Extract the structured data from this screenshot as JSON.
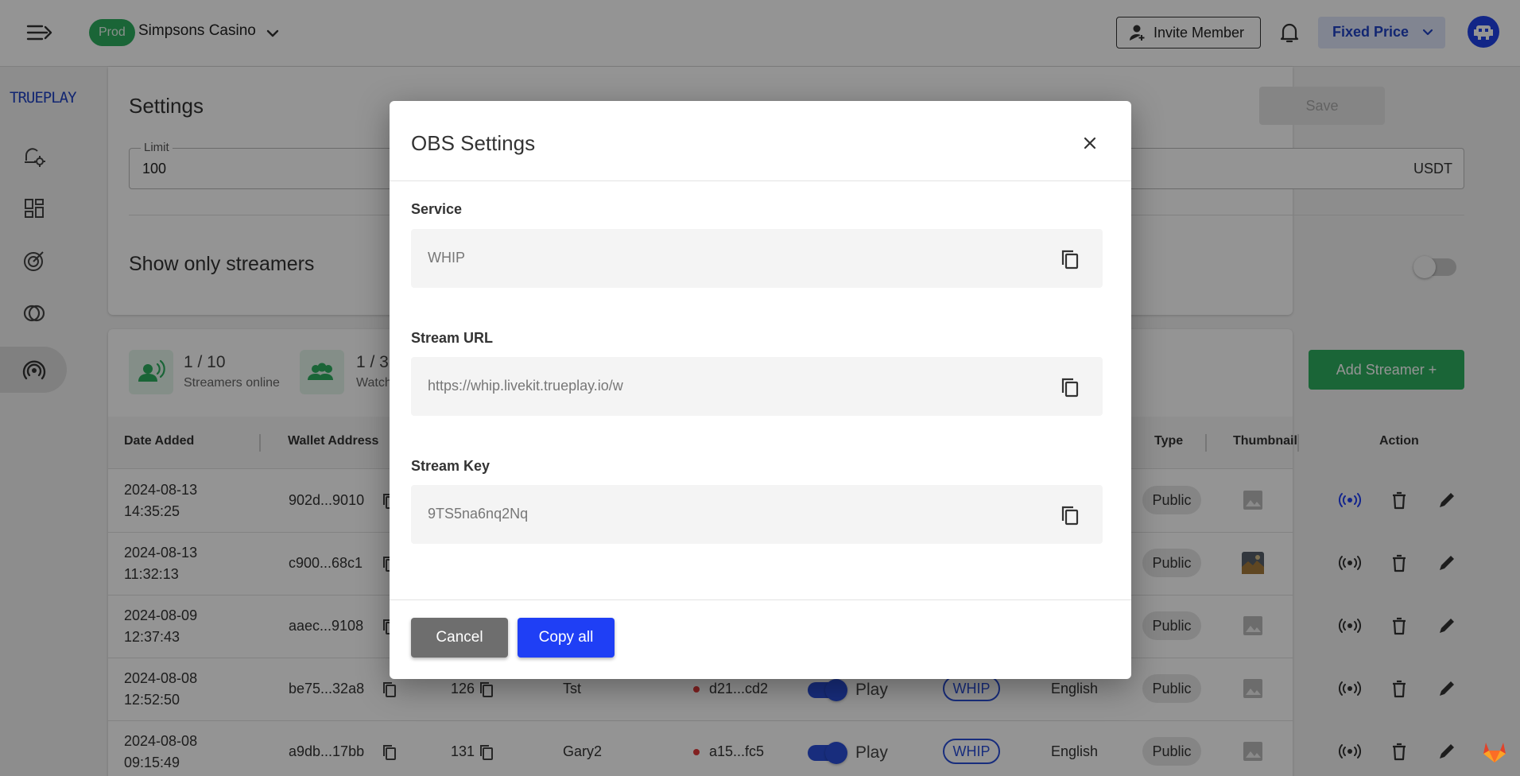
{
  "header": {
    "env_badge": "Prod",
    "casino_name": "Simpsons Casino",
    "invite_label": "Invite Member",
    "price_label": "Fixed Price"
  },
  "sidebar": {
    "logo": "TRUEPLAY",
    "icons": [
      "bell-gear-icon",
      "dashboard-icon",
      "target-icon",
      "rings-icon",
      "broadcast-icon"
    ],
    "active_index": 4
  },
  "settings": {
    "title": "Settings",
    "save_label": "Save",
    "limit_label": "Limit",
    "limit_value": "100",
    "limit_unit": "USDT",
    "show_streamers_label": "Show only streamers"
  },
  "streamers": {
    "online_value": "1 / 10",
    "online_label": "Streamers online",
    "watch_value": "1 / 3",
    "watch_label": "Watch",
    "add_label": "Add Streamer +",
    "columns": {
      "date": "Date Added",
      "wallet": "Wallet Address",
      "type": "Type",
      "thumbnail": "Thumbnail",
      "action": "Action"
    },
    "rows": [
      {
        "date1": "2024-08-13",
        "date2": "14:35:25",
        "wallet": "902d...9010",
        "num": "",
        "name": "",
        "room": "",
        "play": "",
        "whip": "",
        "lang": "",
        "type": "Public"
      },
      {
        "date1": "2024-08-13",
        "date2": "11:32:13",
        "wallet": "c900...68c1",
        "num": "",
        "name": "",
        "room": "",
        "play": "",
        "whip": "",
        "lang": "",
        "type": "Public"
      },
      {
        "date1": "2024-08-09",
        "date2": "12:37:43",
        "wallet": "aaec...9108",
        "num": "",
        "name": "",
        "room": "",
        "play": "",
        "whip": "",
        "lang": "",
        "type": "Public"
      },
      {
        "date1": "2024-08-08",
        "date2": "12:52:50",
        "wallet": "be75...32a8",
        "num": "126",
        "name": "Tst",
        "room": "d21...cd2",
        "play": "Play",
        "whip": "WHIP",
        "lang": "English",
        "type": "Public"
      },
      {
        "date1": "2024-08-08",
        "date2": "09:15:49",
        "wallet": "a9db...17bb",
        "num": "131",
        "name": "Gary2",
        "room": "a15...fc5",
        "play": "Play",
        "whip": "WHIP",
        "lang": "English",
        "type": "Public"
      }
    ]
  },
  "modal": {
    "title": "OBS Settings",
    "service_label": "Service",
    "service_value": "WHIP",
    "url_label": "Stream URL",
    "url_value": "https://whip.livekit.trueplay.io/w",
    "key_label": "Stream Key",
    "key_value": "9TS5na6nq2Nq",
    "cancel_label": "Cancel",
    "copy_all_label": "Copy all"
  },
  "colors": {
    "primary_blue": "#1f3ff5",
    "green": "#2eae5f",
    "red_dot": "#e03a3a"
  }
}
